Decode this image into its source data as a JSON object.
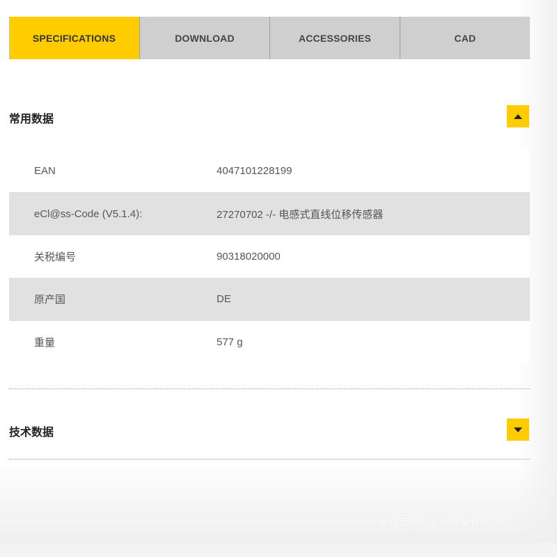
{
  "tabs": [
    {
      "label": "SPECIFICATIONS",
      "active": true
    },
    {
      "label": "DOWNLOAD",
      "active": false
    },
    {
      "label": "ACCESSORIES",
      "active": false
    },
    {
      "label": "CAD",
      "active": false
    }
  ],
  "general_section": {
    "title": "常用数据",
    "toggle_icon": "chevron-up-icon",
    "rows": [
      {
        "key": "EAN",
        "value": "4047101228199"
      },
      {
        "key": "eCl@ss-Code (V5.1.4):",
        "value": "27270702 -/- 电感式直线位移传感器"
      },
      {
        "key": "关税编号",
        "value": "90318020000"
      },
      {
        "key": "原产国",
        "value": "DE"
      },
      {
        "key": "重量",
        "value": "577 g"
      }
    ]
  },
  "technical_section": {
    "title": "技术数据",
    "toggle_icon": "chevron-down-icon"
  },
  "watermark": "东莞市展妙蓝创贸易有限公司",
  "colors": {
    "accent": "#ffcc00",
    "tab_bg": "#cfcfcf",
    "row_alt": "#e1e1e1"
  }
}
